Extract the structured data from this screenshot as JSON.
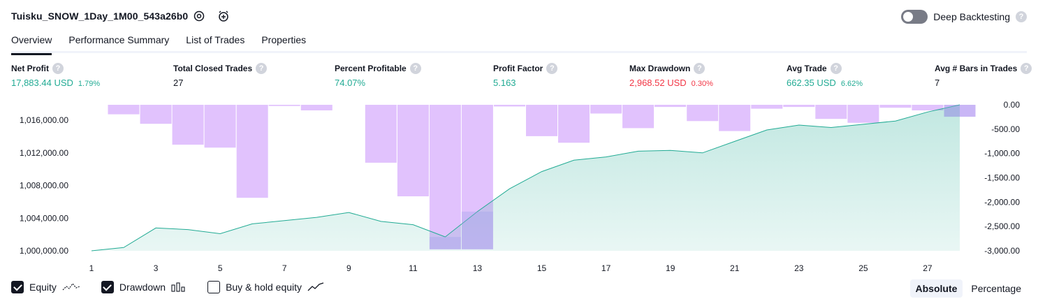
{
  "header": {
    "strategy_name": "Tuisku_SNOW_1Day_1M00_543a26b0",
    "deep_backtesting_label": "Deep Backtesting",
    "help_glyph": "?"
  },
  "tabs": [
    {
      "label": "Overview"
    },
    {
      "label": "Performance Summary"
    },
    {
      "label": "List of Trades"
    },
    {
      "label": "Properties"
    }
  ],
  "metrics": [
    {
      "label": "Net Profit",
      "value": "17,883.44 USD",
      "pct": "1.79%",
      "color": "#22ab94"
    },
    {
      "label": "Total Closed Trades",
      "value": "27",
      "pct": "",
      "color": "#131722"
    },
    {
      "label": "Percent Profitable",
      "value": "74.07%",
      "pct": "",
      "color": "#22ab94"
    },
    {
      "label": "Profit Factor",
      "value": "5.163",
      "pct": "",
      "color": "#22ab94"
    },
    {
      "label": "Max Drawdown",
      "value": "2,968.52 USD",
      "pct": "0.30%",
      "color": "#f23645"
    },
    {
      "label": "Avg Trade",
      "value": "662.35 USD",
      "pct": "6.62%",
      "color": "#22ab94"
    },
    {
      "label": "Avg # Bars in Trades",
      "value": "7",
      "pct": "",
      "color": "#131722"
    }
  ],
  "chart_data": {
    "type": "area",
    "x": [
      1,
      2,
      3,
      4,
      5,
      6,
      7,
      8,
      9,
      10,
      11,
      12,
      13,
      14,
      15,
      16,
      17,
      18,
      19,
      20,
      21,
      22,
      23,
      24,
      25,
      26,
      27,
      28
    ],
    "x_tick_labels": [
      "1",
      "3",
      "5",
      "7",
      "9",
      "11",
      "13",
      "15",
      "17",
      "19",
      "21",
      "23",
      "25",
      "27"
    ],
    "series": [
      {
        "name": "Equity",
        "axis": "left",
        "color": "#22ab94",
        "values": [
          1000000,
          1000400,
          1002800,
          1002600,
          1002100,
          1003300,
          1003700,
          1004100,
          1004700,
          1003600,
          1003200,
          1001700,
          1004800,
          1007600,
          1009700,
          1011100,
          1011500,
          1012200,
          1012300,
          1012000,
          1013400,
          1014800,
          1015400,
          1015100,
          1015500,
          1015900,
          1017000,
          1017883.44
        ]
      },
      {
        "name": "Drawdown",
        "axis": "right",
        "color": "#d1aaf9",
        "values": [
          0,
          -195,
          -390,
          -820,
          -880,
          -1910,
          -25,
          -115,
          0,
          -1190,
          -1880,
          -2968.52,
          -2968.52,
          -35,
          -645,
          -780,
          -180,
          -480,
          -45,
          -335,
          -540,
          -80,
          -45,
          -290,
          -370,
          -60,
          -115,
          -245
        ]
      }
    ],
    "yleft_ticks": [
      "1,000,000.00",
      "1,004,000.00",
      "1,008,000.00",
      "1,012,000.00",
      "1,016,000.00"
    ],
    "yleft_values": [
      1000000,
      1004000,
      1008000,
      1012000,
      1016000
    ],
    "ylim_left": [
      1000000,
      1017883.44
    ],
    "yright_ticks": [
      "0.00",
      "-500.00",
      "-1,000.00",
      "-1,500.00",
      "-2,000.00",
      "-2,500.00",
      "-3,000.00"
    ],
    "yright_values": [
      0,
      -500,
      -1000,
      -1500,
      -2000,
      -2500,
      -3000
    ],
    "ylim_right": [
      -3000,
      0
    ]
  },
  "legend": {
    "equity_label": "Equity",
    "drawdown_label": "Drawdown",
    "buyhold_label": "Buy & hold equity",
    "equity_checked": true,
    "drawdown_checked": true,
    "buyhold_checked": false
  },
  "modes": {
    "absolute_label": "Absolute",
    "percentage_label": "Percentage",
    "selected": "Absolute"
  },
  "colors": {
    "accent_green": "#22ab94",
    "accent_red": "#f23645",
    "drawdown_fill": "#e1c2fd",
    "text": "#131722"
  }
}
